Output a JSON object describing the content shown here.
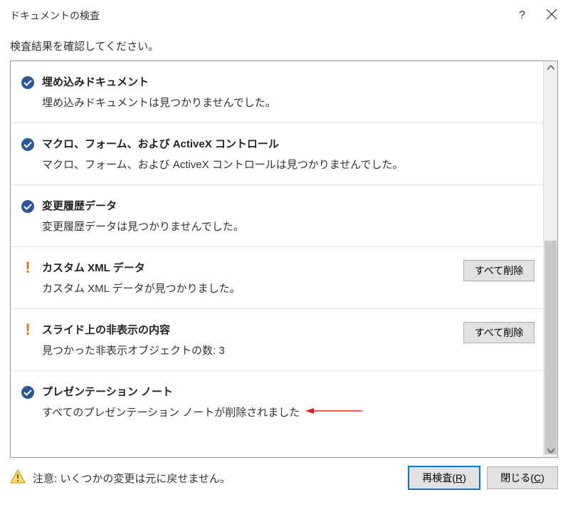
{
  "dialog": {
    "title": "ドキュメントの検査",
    "instructions": "検査結果を確認してください。"
  },
  "results": [
    {
      "status": "ok",
      "title": "埋め込みドキュメント",
      "desc": "埋め込みドキュメントは見つかりませんでした。"
    },
    {
      "status": "ok",
      "title": "マクロ、フォーム、および ActiveX コントロール",
      "desc": "マクロ、フォーム、および ActiveX コントロールは見つかりませんでした。"
    },
    {
      "status": "ok",
      "title": "変更履歴データ",
      "desc": "変更履歴データは見つかりませんでした。"
    },
    {
      "status": "warn",
      "title": "カスタム XML データ",
      "desc": "カスタム XML データが見つかりました。",
      "action": "すべて削除"
    },
    {
      "status": "warn",
      "title": "スライド上の非表示の内容",
      "desc": "見つかった非表示オブジェクトの数: 3",
      "action": "すべて削除"
    },
    {
      "status": "ok",
      "title": "プレゼンテーション ノート",
      "desc": "すべてのプレゼンテーション ノートが削除されました",
      "arrow": true
    }
  ],
  "footer": {
    "warning": "注意: いくつかの変更は元に戻せません。",
    "reinspect_prefix": "再検査(",
    "reinspect_key": "R",
    "reinspect_suffix": ")",
    "close_prefix": "閉じる(",
    "close_key": "C",
    "close_suffix": ")"
  }
}
